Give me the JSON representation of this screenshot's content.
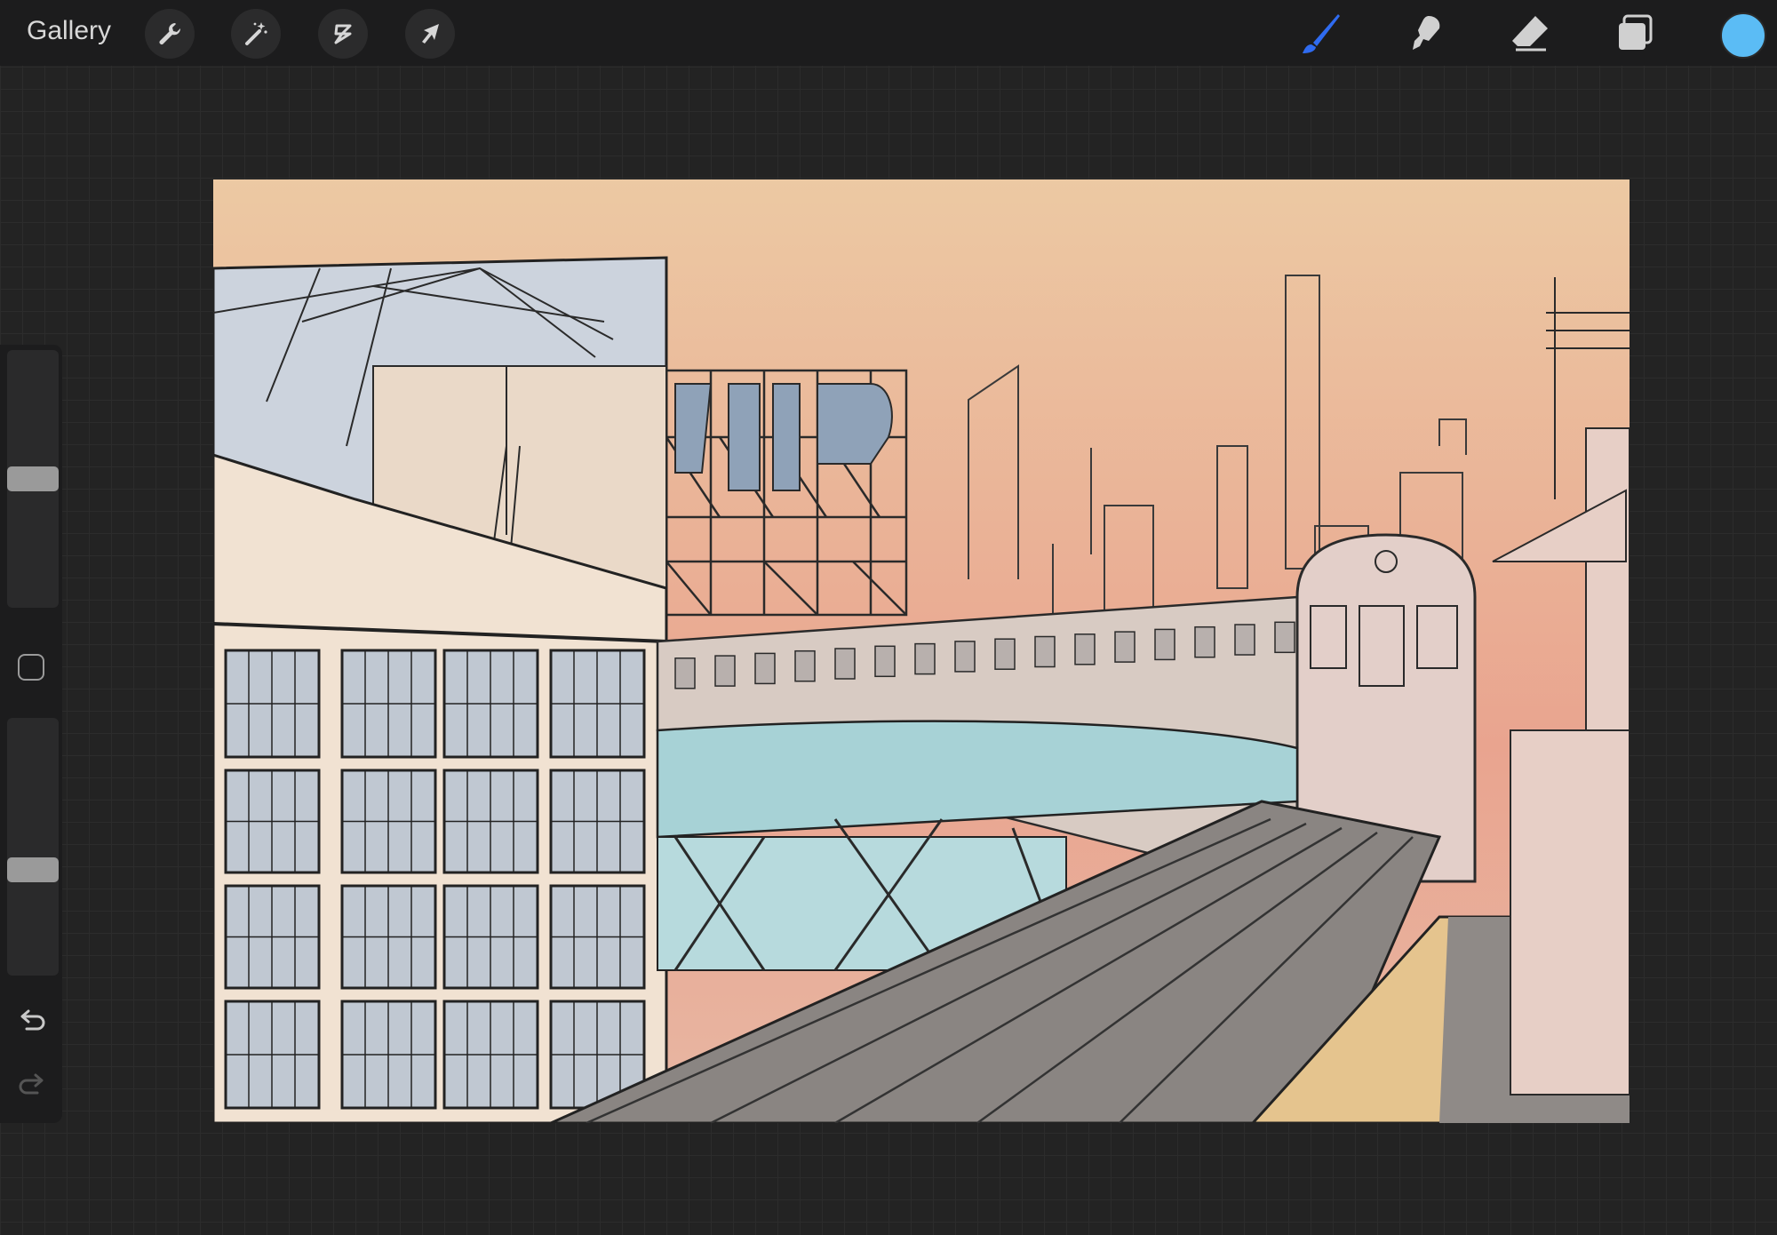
{
  "topbar": {
    "gallery_label": "Gallery",
    "left_tools": [
      "wrench-icon",
      "magic-wand-icon",
      "selection-icon",
      "transform-arrow-icon"
    ],
    "right_tools": [
      "brush-icon",
      "smudge-icon",
      "eraser-icon",
      "layers-icon"
    ],
    "active_tool": "brush-icon",
    "active_tool_color": "#2f6bf0",
    "current_color": "#5bbcf5"
  },
  "sidebar": {
    "brush_size_level": 0.5,
    "brush_opacity_level": 0.4,
    "modifier_icon": "square-modifier-icon",
    "undo_icon": "undo-icon",
    "redo_icon": "redo-icon"
  },
  "canvas": {
    "sky_top_color": "#ecc9a3",
    "sky_bottom_color": "#e9a48f",
    "platform_color": "#e5c48e",
    "structure_color": "#9fcfd3"
  }
}
